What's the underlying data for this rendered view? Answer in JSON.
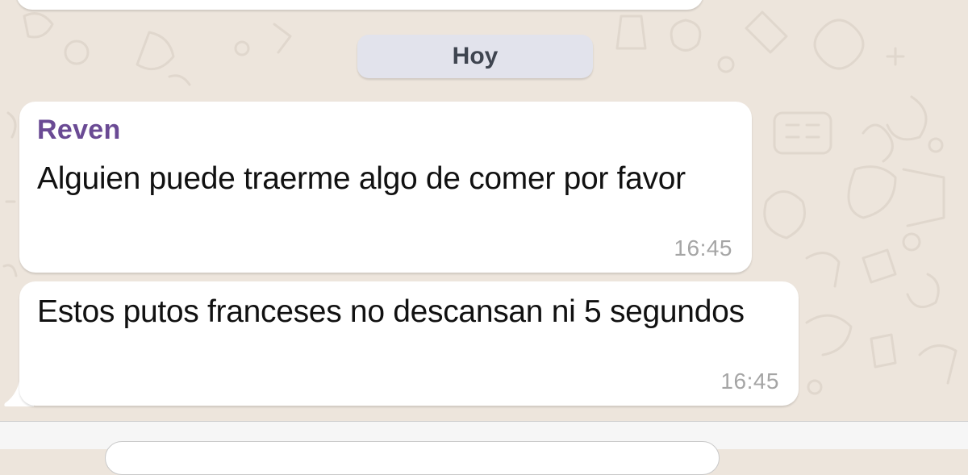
{
  "chat": {
    "date_divider": "Hoy",
    "messages": [
      {
        "sender": "Reven",
        "text": "Alguien puede traerme algo de comer por favor",
        "time": "16:45"
      },
      {
        "text": "Estos putos franceses no descansan ni 5 segundos",
        "time": "16:45"
      }
    ]
  },
  "colors": {
    "background": "#ede5dc",
    "bubble": "#ffffff",
    "sender_name": "#6a4a94",
    "date_pill": "#e2e3ec",
    "timestamp": "#a5a5a5"
  },
  "icons": [
    "chat-wallpaper-doodles"
  ]
}
